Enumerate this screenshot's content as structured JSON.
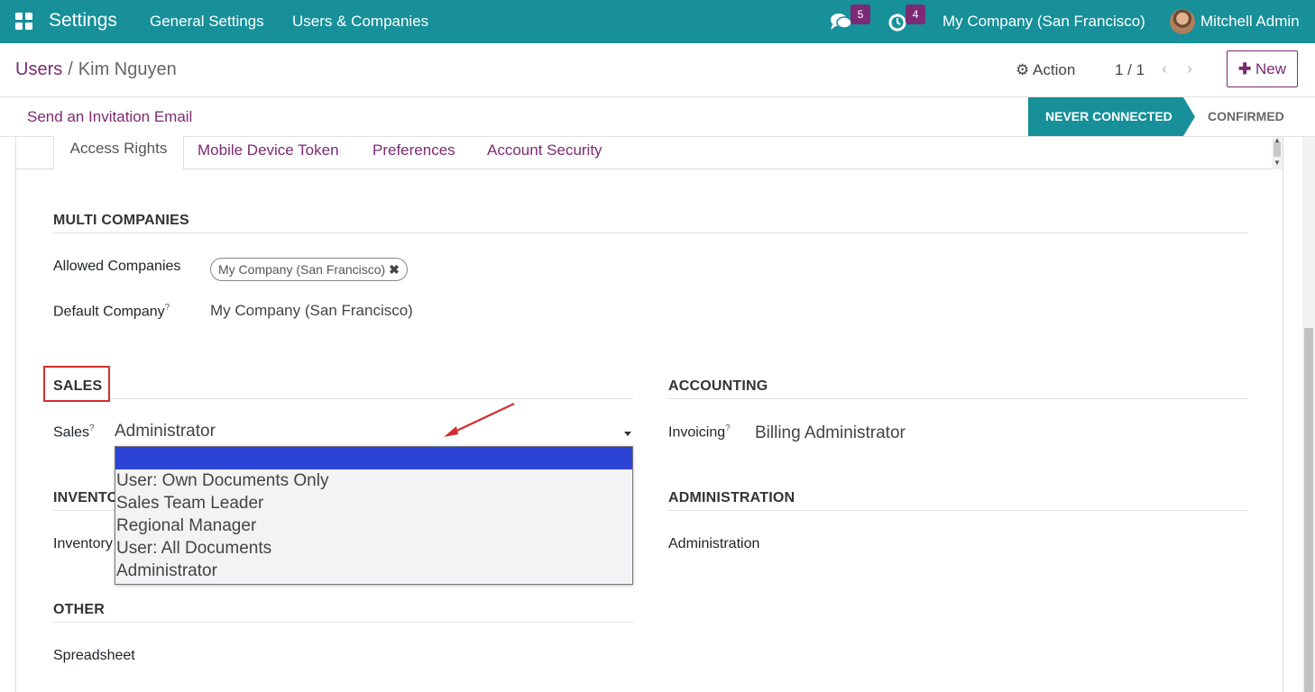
{
  "navbar": {
    "app_name": "Settings",
    "menu": [
      "General Settings",
      "Users & Companies"
    ],
    "messages_count": "5",
    "activities_count": "4",
    "company": "My Company (San Francisco)",
    "user": "Mitchell Admin"
  },
  "control_panel": {
    "breadcrumb_parent": "Users",
    "breadcrumb_sep": "/",
    "breadcrumb_current": "Kim Nguyen",
    "action_label": "Action",
    "pager": "1 / 1",
    "new_label": "New"
  },
  "statusbar": {
    "invite_label": "Send an Invitation Email",
    "stages": [
      "NEVER CONNECTED",
      "CONFIRMED"
    ],
    "active_stage": "NEVER CONNECTED"
  },
  "tabs": [
    "Access Rights",
    "Mobile Device Token",
    "Preferences",
    "Account Security"
  ],
  "active_tab": "Access Rights",
  "multi_companies": {
    "title": "MULTI COMPANIES",
    "allowed_label": "Allowed Companies",
    "allowed_tag": "My Company (San Francisco)",
    "default_label": "Default Company",
    "default_value": "My Company (San Francisco)"
  },
  "sales": {
    "title": "SALES",
    "field_label": "Sales",
    "value": "Administrator",
    "options": [
      "",
      "User: Own Documents Only",
      "Sales Team Leader",
      "Regional Manager",
      "User: All Documents",
      "Administrator"
    ]
  },
  "accounting": {
    "title": "ACCOUNTING",
    "field_label": "Invoicing",
    "value": "Billing Administrator"
  },
  "inventory": {
    "title": "INVENTORY",
    "field_label": "Inventory"
  },
  "administration": {
    "title": "ADMINISTRATION",
    "field_label": "Administration"
  },
  "other": {
    "title": "OTHER",
    "field_label": "Spreadsheet"
  },
  "tooltip_mark": "?",
  "colors": {
    "navbar": "#17909a",
    "brand_purple": "#7c2a74",
    "dropdown_highlight": "#2b44d6",
    "annotation_red": "#d32f2f"
  }
}
